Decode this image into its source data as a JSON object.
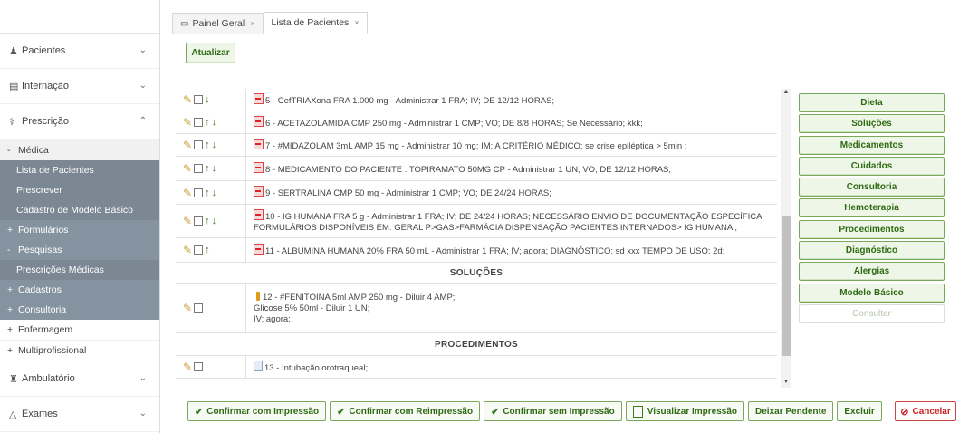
{
  "sidebar": {
    "items": [
      {
        "label": "Pacientes",
        "icon": "user-icon"
      },
      {
        "label": "Internação",
        "icon": "bed-icon"
      },
      {
        "label": "Prescrição",
        "icon": "stethoscope-icon"
      }
    ],
    "prescricao_sub": {
      "medica": "Médica",
      "lista": "Lista de Pacientes",
      "prescrever": "Prescrever",
      "cadastro": "Cadastro de Modelo Básico",
      "formularios": "Formulários",
      "pesquisas": "Pesquisas",
      "prescricoes": "Prescrições Médicas",
      "cadastros": "Cadastros",
      "consultoria": "Consultoria",
      "enfermagem": "Enfermagem",
      "multiprofissional": "Multiprofissional"
    },
    "bottom_items": [
      {
        "label": "Ambulatório",
        "icon": "hospital-icon"
      },
      {
        "label": "Exames",
        "icon": "flask-icon"
      }
    ]
  },
  "tabs": [
    {
      "label": "Painel Geral",
      "close": "×"
    },
    {
      "label": "Lista de Pacientes",
      "close": "×"
    }
  ],
  "toolbar": {
    "refresh_label": "Atualizar"
  },
  "prescription_rows": [
    {
      "text": "5 - CefTRIAXona FRA 1.000 mg - Administrar 1 FRA; IV; DE 12/12 HORAS;"
    },
    {
      "text": "6 - ACETAZOLAMIDA CMP 250 mg - Administrar 1 CMP; VO; DE 8/8 HORAS; Se Necessário; kkk;"
    },
    {
      "text": "7 - #MIDAZOLAM 3mL AMP 15 mg - Administrar 10 mg; IM; A CRITÉRIO MÉDICO; se crise epiléptica > 5min ;"
    },
    {
      "text": "8 - MEDICAMENTO DO PACIENTE : TOPIRAMATO 50MG CP - Administrar 1 UN; VO; DE 12/12 HORAS;"
    },
    {
      "text": "9 - SERTRALINA CMP 50 mg - Administrar 1 CMP; VO; DE 24/24 HORAS;"
    },
    {
      "text_line1": "10 - IG HUMANA FRA 5 g - Administrar 1 FRA; IV; DE 24/24 HORAS; NECESSÁRIO ENVIO DE DOCUMENTAÇÃO ESPECÍFICA",
      "text_line2": "FORMULÁRIOS DISPONÍVEIS EM: GERAL P>GAS>FARMÁCIA DISPENSAÇÃO PACIENTES INTERNADOS> IG HUMANA ;"
    },
    {
      "text": "11 - ALBUMINA HUMANA 20% FRA 50 mL - Administrar 1 FRA; IV; agora; DIAGNÓSTICO: sd xxx TEMPO DE USO: 2d;"
    }
  ],
  "sections": {
    "solucoes": "SOLUÇÕES",
    "procedimentos": "PROCEDIMENTOS"
  },
  "solution_row": {
    "line1": "12 - #FENITOINA 5ml AMP 250 mg - Diluir 4 AMP;",
    "line2": "Glicose 5% 50ml - Diluir 1 UN;",
    "line3": "IV; agora;"
  },
  "procedure_row": {
    "text": "13 - Intubação orotraqueal;"
  },
  "categories": [
    "Dieta",
    "Soluções",
    "Medicamentos",
    "Cuidados",
    "Consultoria",
    "Hemoterapia",
    "Procedimentos",
    "Diagnóstico",
    "Alergias",
    "Modelo Básico",
    "Consultar"
  ],
  "footer": {
    "confirm_print": "Confirmar com Impressão",
    "confirm_reprint": "Confirmar com Reimpressão",
    "confirm_no_print": "Confirmar sem Impressão",
    "view_print": "Visualizar Impressão",
    "leave_pending": "Deixar Pendente",
    "delete": "Excluir",
    "cancel": "Cancelar"
  },
  "colors": {
    "accent_green": "#2e6a12",
    "sidebar_active": "#7b8893",
    "cancel_red": "#cc2222"
  }
}
